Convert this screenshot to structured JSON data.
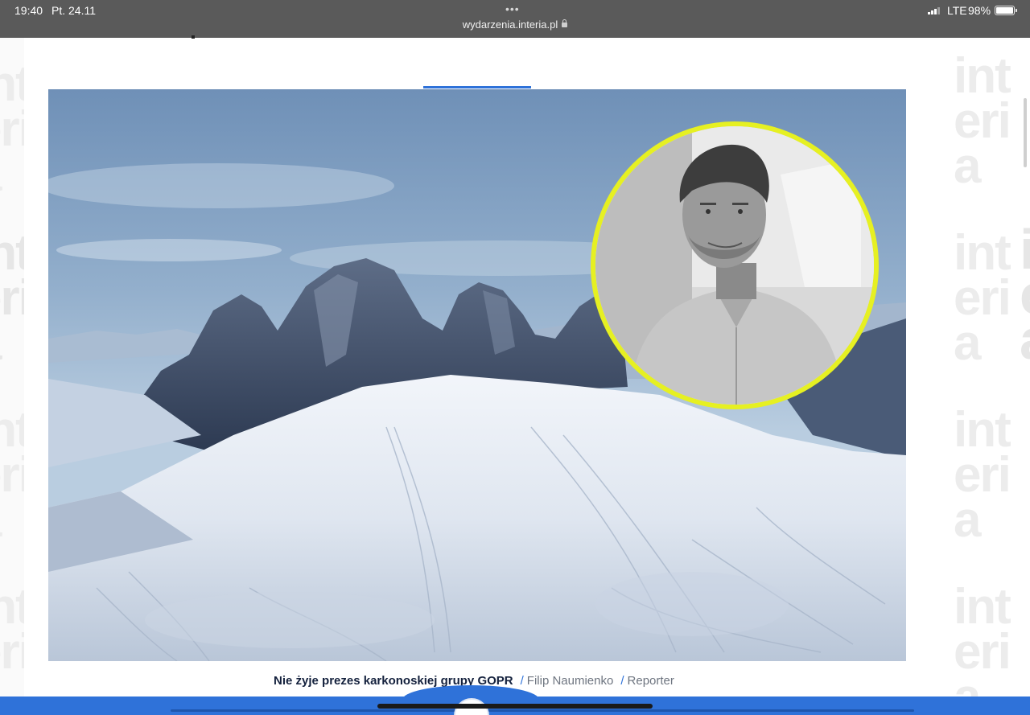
{
  "status_bar": {
    "time": "19:40",
    "date": "Pt. 24.11",
    "dots": "•••",
    "url": "wydarzenia.interia.pl",
    "network": "LTE",
    "battery": "98%",
    "battery_level": 0.98
  },
  "watermark": {
    "right_block": "int\neri\na",
    "left_block": "int\neri\na"
  },
  "video": {
    "caption_title": "Nie żyje prezes karkonoskiej grupy GOPR",
    "separator": "/",
    "author": "Filip Naumienko",
    "role": "Reporter"
  },
  "colors": {
    "accent": "#2f72d9",
    "avatar_ring": "#e6f022",
    "status_bar": "#5a5a5a"
  }
}
